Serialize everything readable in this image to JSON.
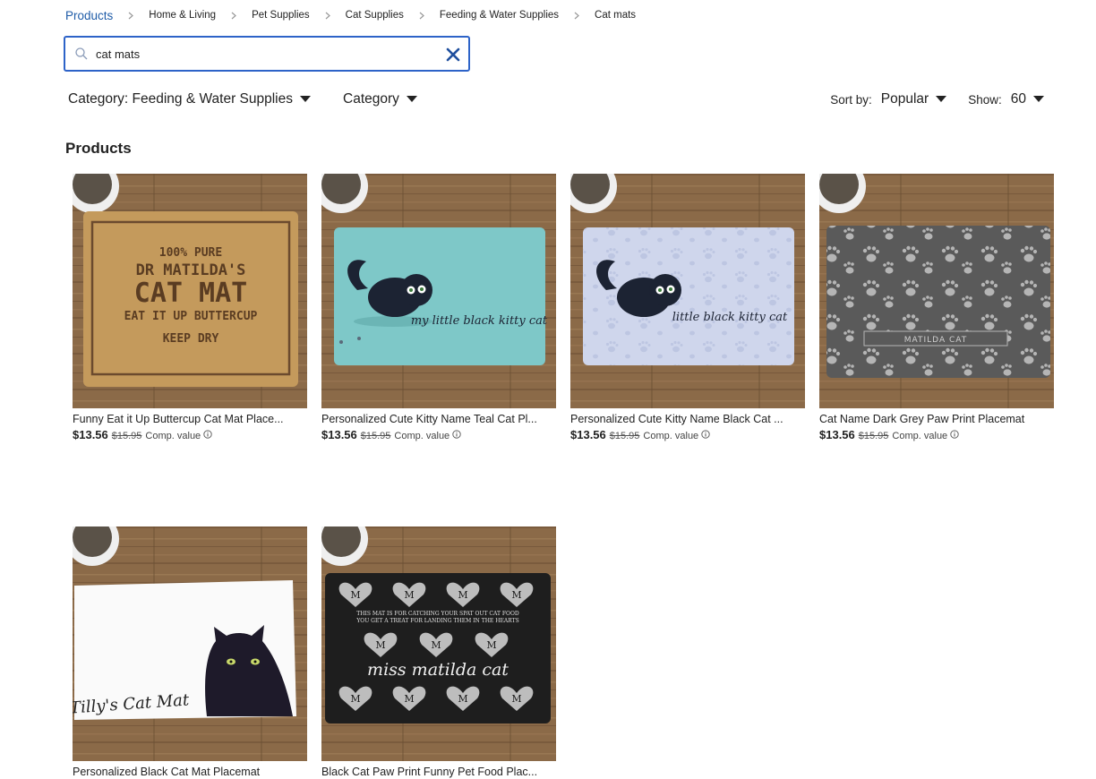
{
  "breadcrumb": {
    "items": [
      "Products",
      "Home & Living",
      "Pet Supplies",
      "Cat Supplies",
      "Feeding & Water Supplies",
      "Cat mats"
    ]
  },
  "search": {
    "value": "cat mats"
  },
  "filters": {
    "category_feeding": "Category: Feeding & Water Supplies",
    "category": "Category"
  },
  "sort": {
    "sort_label": "Sort by:",
    "sort_value": "Popular",
    "show_label": "Show:",
    "show_value": "60"
  },
  "section_title": "Products",
  "products": [
    {
      "title": "Funny Eat it Up Buttercup Cat Mat Place...",
      "price": "$13.56",
      "original": "$15.95",
      "comp": "Comp. value",
      "art": {
        "line1": "100% PURE",
        "line2": "DR MATILDA'S",
        "line3": "CAT MAT",
        "line4": "EAT IT UP BUTTERCUP",
        "line5": "KEEP DRY"
      }
    },
    {
      "title": "Personalized Cute Kitty Name Teal Cat Pl...",
      "price": "$13.56",
      "original": "$15.95",
      "comp": "Comp. value",
      "art": {
        "line1": "my little black kitty cat"
      }
    },
    {
      "title": "Personalized Cute Kitty Name Black Cat ...",
      "price": "$13.56",
      "original": "$15.95",
      "comp": "Comp. value",
      "art": {
        "line1": "little black kitty cat"
      }
    },
    {
      "title": "Cat Name Dark Grey Paw Print Placemat",
      "price": "$13.56",
      "original": "$15.95",
      "comp": "Comp. value",
      "art": {
        "line1": "MATILDA CAT"
      }
    },
    {
      "title": "Personalized Black Cat Mat Placemat",
      "art": {
        "line1": "Tilly's Cat Mat"
      }
    },
    {
      "title": "Black Cat Paw Print Funny Pet Food Plac...",
      "art": {
        "line1": "THIS MAT IS FOR CATCHING YOUR SPAT OUT CAT FOOD",
        "line2": "YOU GET A TREAT FOR LANDING THEM IN THE HEARTS",
        "line3": "miss matilda cat",
        "heart_letter": "M"
      }
    }
  ],
  "colors": {
    "link_blue": "#1f5ca8",
    "search_border": "#2d63c8",
    "wood": "#8a6a4a",
    "teal_mat": "#7ec8c8",
    "lavender_mat": "#cfd6ec",
    "grey_mat": "#5a5a5a",
    "black_mat": "#1e1e1e",
    "kraft_mat": "#c29a5a"
  }
}
